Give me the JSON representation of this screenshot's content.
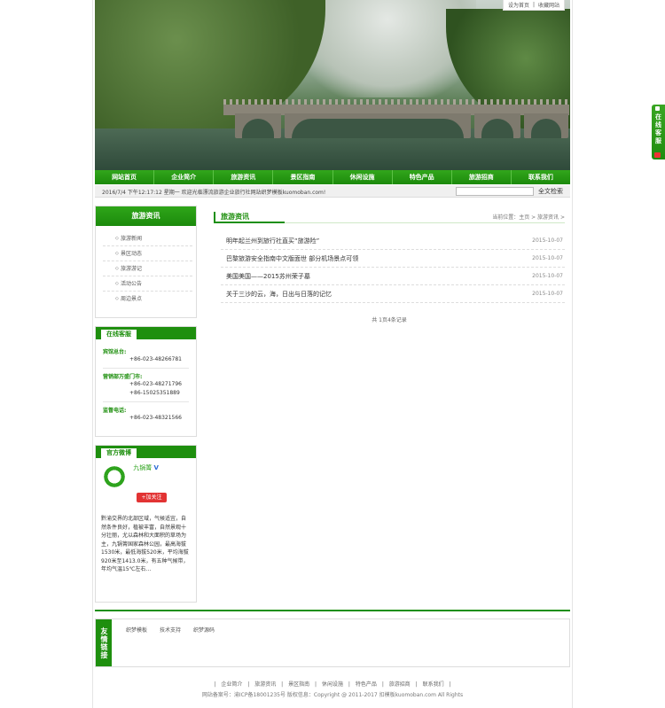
{
  "top_links": [
    "设为首页",
    "|",
    "收藏网站"
  ],
  "nav": [
    "网站首页",
    "企业简介",
    "旅游资讯",
    "景区指南",
    "休闲设施",
    "特色产品",
    "旅游招商",
    "联系我们"
  ],
  "notice": {
    "datetime": "2016/7/4 下午12:17:12 星期一  欢迎光临漂流旅游企业旅行社网站织梦模板kuomoban.com!",
    "search_button": "全文检索"
  },
  "sidebar": {
    "category_title": "旅游资讯",
    "categories": [
      "旅游新闻",
      "景区动态",
      "旅游游记",
      "活动公告",
      "周边景点"
    ],
    "service_title": "在线客服",
    "contacts": [
      {
        "label": "宾馆总台:",
        "phones": [
          "+86-023-48266781"
        ]
      },
      {
        "label": "营销部万盛门市:",
        "phones": [
          "+86-023-48271796",
          "+86-15025351889"
        ]
      },
      {
        "label": "监督电话:",
        "phones": [
          "+86-023-48321566"
        ]
      }
    ],
    "weibo_title": "官方微博",
    "weibo_name": "九锅箐",
    "weibo_verified": "V",
    "weibo_follow": "+加关注",
    "weibo_desc": "黔渝交界的北部区域，气候适宜，自然条件良好，植被丰富，自然景观十分壮丽，尤以森林和大面积的草场为主，九锅箐国家森林公园，最高海拔1530米，最低海拔520米，平均海拔920米至1413.0米，有五种气候带，年均气温15℃左右…"
  },
  "main": {
    "title": "旅游资讯",
    "breadcrumb": "当前位置：主页 > 旅游资讯 >",
    "news": [
      {
        "title": "明年起兰州到旅行社直买“旅游险”",
        "date": "2015-10-07"
      },
      {
        "title": "巴黎旅游安全指南中文版面世 部分机场景点可领",
        "date": "2015-10-07"
      },
      {
        "title": "美国美国——2015苏州荣子墓",
        "date": "2015-10-07"
      },
      {
        "title": "关于三沙的云，海，日出与日落的记忆",
        "date": "2015-10-07"
      }
    ],
    "pager": "共 1页4条记录"
  },
  "friends": {
    "label": "友情链接",
    "links": [
      "织梦模板",
      "技术支持",
      "织梦源码"
    ]
  },
  "footer": {
    "nav": [
      "|",
      "企业简介",
      "|",
      "旅游资讯",
      "|",
      "景区指南",
      "|",
      "休闲设施",
      "|",
      "特色产品",
      "|",
      "旅游招商",
      "|",
      "联系我们",
      "|"
    ],
    "copyright": "网站备案号：渝ICP备18001235号  版权信息：Copyright @ 2011-2017 扣模板kuomoban.com All Rights"
  },
  "float_service": "在线客服"
}
